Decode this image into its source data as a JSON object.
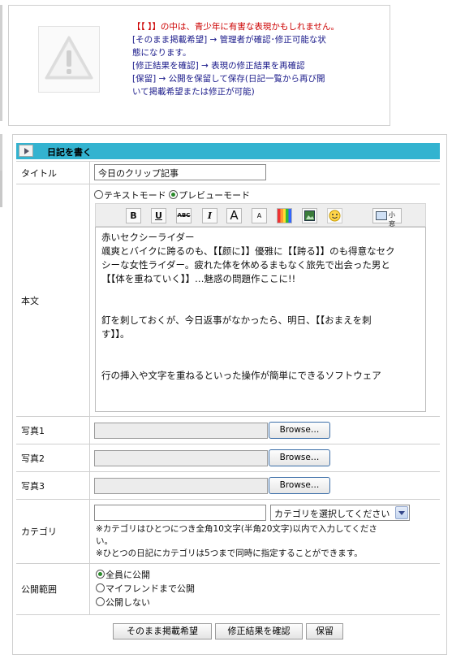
{
  "warning": {
    "line1_red": "【【 】】の中は、青少年に有害な表現かもしれません。",
    "line2": "[そのまま掲載希望] → 管理者が確認･修正可能な状",
    "line3": "態になります。",
    "line4": "[修正結果を確認] → 表現の修正結果を再確認",
    "line5": "[保留] → 公開を保留して保存(日記一覧から再び開",
    "line6": "いて掲載希望または修正が可能)"
  },
  "form": {
    "header": "日記を書く",
    "title_label": "タイトル",
    "title_value": "今日のクリップ記事",
    "body_label": "本文",
    "mode_text": "テキストモード",
    "mode_preview": "プレビューモード",
    "toolbar": {
      "bold": "B",
      "underline": "U",
      "strike": "ABC",
      "italic": "I",
      "large": "A",
      "small": "A",
      "small_window": "小窓"
    },
    "body_lines": [
      "赤いセクシーライダー",
      "颯爽とバイクに跨るのも、【【颜に】】優雅に【【跨る】】のも得意なセク",
      "シーな女性ライダー。疲れた体を休めるまもなく旅先で出会った男と",
      "【【体を重ねていく】】…魅惑の問題作ここに!!",
      "釘を刺しておくが、今日返事がなかったら、明日、【【おまえを刺",
      "す】】。",
      "行の挿入や文字を重ねるといった操作が簡単にできるソフトウェア"
    ],
    "photo1_label": "写真1",
    "photo2_label": "写真2",
    "photo3_label": "写真3",
    "browse_label": "Browse…",
    "category_label": "カテゴリ",
    "category_placeholder": "",
    "category_select": "カテゴリを選択してください",
    "category_note1": "※カテゴリはひとつにつき全角10文字(半角20文字)以内で入力してくださ",
    "category_note1b": "い。",
    "category_note2": "※ひとつの日記にカテゴリは5つまで同時に指定することができます。",
    "visibility_label": "公開範囲",
    "visibility_options": [
      "全員に公開",
      "マイフレンドまで公開",
      "公開しない"
    ],
    "btn_publish": "そのまま掲載希望",
    "btn_check": "修正結果を確認",
    "btn_hold": "保留"
  },
  "colors": {
    "header_bg": "#33b3d0",
    "warning_red": "#cc0000",
    "warning_text": "#1a1a8a"
  }
}
